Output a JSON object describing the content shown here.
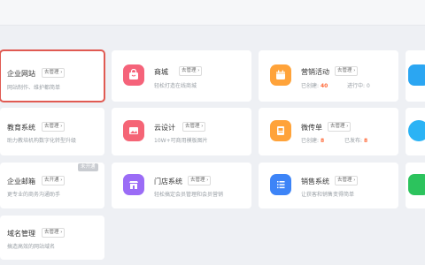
{
  "cards": [
    {
      "id": "site",
      "title": "企业网站",
      "link": "去管理",
      "desc": "网站制作、维护都简单"
    },
    {
      "id": "mall",
      "title": "商城",
      "link": "去管理",
      "desc": "轻松打造在线商城"
    },
    {
      "id": "marketing",
      "title": "营销活动",
      "link": "去管理",
      "stat1_label": "已创建:",
      "stat1_value": "40",
      "stat2_label": "进行中:",
      "stat2_value": "0"
    },
    {
      "id": "edu",
      "title": "教育系统",
      "link": "去管理",
      "desc": "助力教培机构数字化转型升级"
    },
    {
      "id": "cloud",
      "title": "云设计",
      "link": "去管理",
      "desc": "10W+可商用模板图片"
    },
    {
      "id": "microform",
      "title": "微传单",
      "link": "去管理",
      "stat1_label": "已创建:",
      "stat1_value": "8",
      "stat2_label": "已发布:",
      "stat2_value": "8"
    },
    {
      "id": "mail",
      "title": "企业邮箱",
      "link": "去开通",
      "desc": "更专业的商务沟通助手",
      "badge": "未开通"
    },
    {
      "id": "store",
      "title": "门店系统",
      "link": "去管理",
      "desc": "轻松搞定会员管理和会员营销"
    },
    {
      "id": "sales",
      "title": "销售系统",
      "link": "去管理",
      "desc": "让获客和销售变得简单"
    },
    {
      "id": "domain",
      "title": "域名管理",
      "link": "去管理",
      "desc": "搞造高效的网站域名"
    }
  ],
  "colors": {
    "mall": "#f5637a",
    "marketing": "#ffa33a",
    "cloud": "#f56576",
    "microform": "#ffa33a",
    "store": "#9b6cf6",
    "sales": "#3d84f7",
    "edge1": "#2ba6f2",
    "edge2": "#2bb3f5",
    "edge3": "#2cc35d"
  }
}
